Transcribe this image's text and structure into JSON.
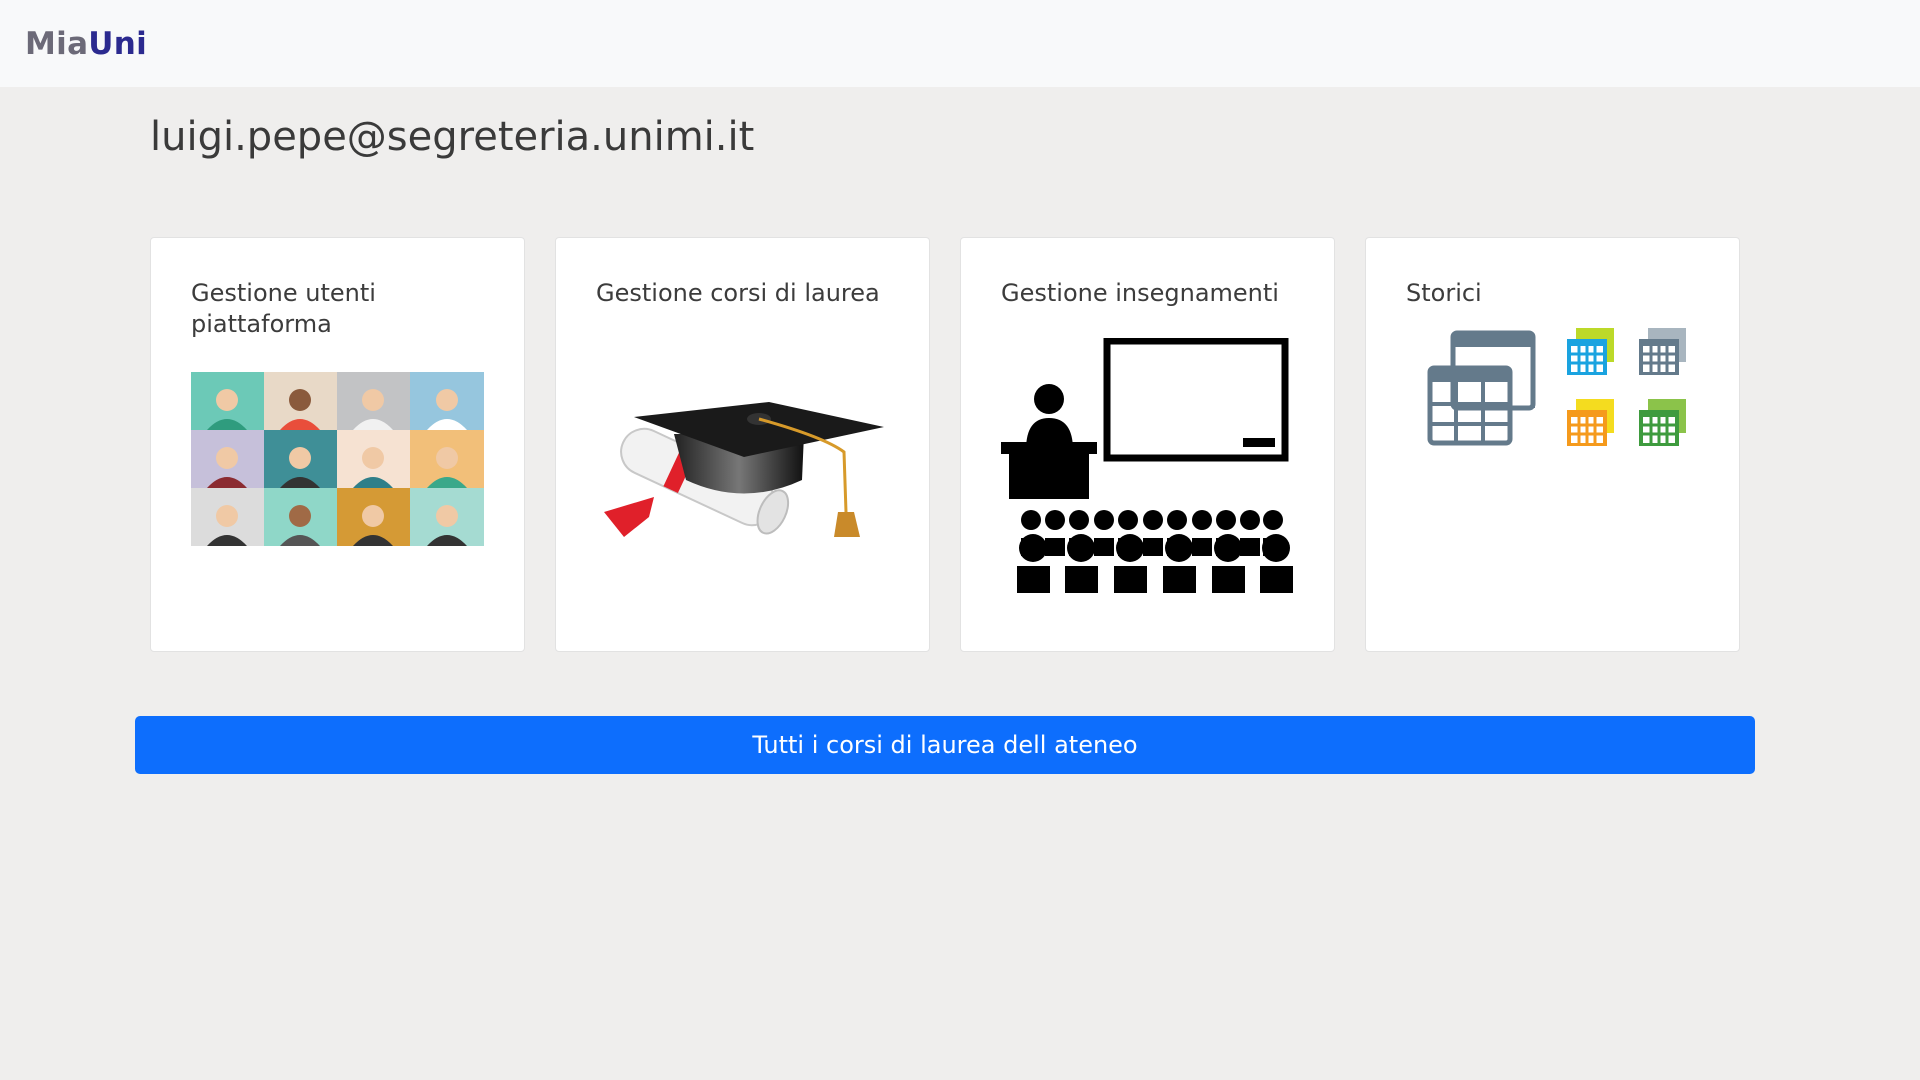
{
  "navbar": {
    "brand_part1": "Mia",
    "brand_part2": "Uni"
  },
  "user": {
    "email": "luigi.pepe@segreteria.unimi.it"
  },
  "cards": [
    {
      "title": "Gestione utenti piattaforma",
      "icon": "people-grid-icon"
    },
    {
      "title": "Gestione corsi di laurea",
      "icon": "graduation-cap-icon"
    },
    {
      "title": "Gestione insegnamenti",
      "icon": "classroom-icon"
    },
    {
      "title": "Storici",
      "icon": "calendar-grid-icon"
    }
  ],
  "main_button": {
    "label": "Tutti i corsi di laurea dell ateneo"
  },
  "colors": {
    "primary": "#0d6efd",
    "background": "#efeeed",
    "navbar": "#f8f9fa",
    "brand_dark": "#2b2a8f"
  }
}
